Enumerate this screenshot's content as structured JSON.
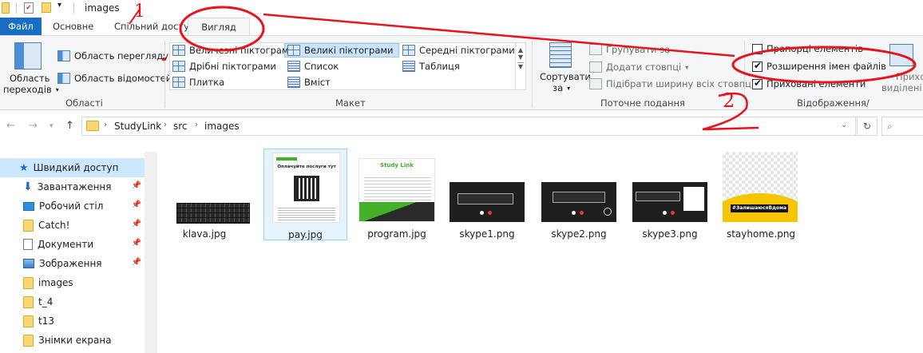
{
  "window": {
    "title": "images"
  },
  "tabs": [
    {
      "label": "Файл"
    },
    {
      "label": "Основне"
    },
    {
      "label": "Спільний доступ"
    },
    {
      "label": "Вигляд"
    }
  ],
  "ribbon": {
    "panes": {
      "nav_pane_line1": "Область",
      "nav_pane_line2": "переходів",
      "preview": "Область перегляду",
      "details": "Область відомостей",
      "group_label": "Області"
    },
    "layout": {
      "items": [
        "Величезні піктограми",
        "Великі піктограми",
        "Середні піктограми",
        "Дрібні піктограми",
        "Список",
        "Таблиця",
        "Плитка",
        "Вміст"
      ],
      "group_label": "Макет"
    },
    "current_view": {
      "sort_line1": "Сортувати",
      "sort_line2": "за",
      "group_by": "Групувати за",
      "add_columns": "Додати стовпці",
      "fit_columns": "Підібрати ширину всіх стовпців",
      "group_label": "Поточне подання"
    },
    "show_hide": {
      "item_checkboxes": "Прапорці елементів",
      "file_extensions": "Розширення імен файлів",
      "hidden_items": "Приховані елементи",
      "hide_line1": "Прихо",
      "hide_line2": "виділені е",
      "group_label": "Відображення/приховання"
    }
  },
  "address": {
    "crumbs": [
      "StudyLink",
      "src",
      "images"
    ]
  },
  "sidebar": {
    "items": [
      {
        "label": "Швидкий доступ"
      },
      {
        "label": "Завантаження"
      },
      {
        "label": "Робочий стіл"
      },
      {
        "label": "Catch!"
      },
      {
        "label": "Документи"
      },
      {
        "label": "Зображення"
      },
      {
        "label": "images"
      },
      {
        "label": "t_4"
      },
      {
        "label": "t13"
      },
      {
        "label": "Знімки екрана"
      }
    ]
  },
  "files": [
    {
      "name": "klava.jpg"
    },
    {
      "name": "pay.jpg",
      "t1": "Оплачуйте послуги тут"
    },
    {
      "name": "program.jpg",
      "t1": "Study Link"
    },
    {
      "name": "skype1.png"
    },
    {
      "name": "skype2.png"
    },
    {
      "name": "skype3.png"
    },
    {
      "name": "stayhome.png",
      "t1": "#ЗалишаюсяВдома"
    }
  ],
  "annotations": {
    "one": "1",
    "two": "2"
  },
  "colors": {
    "accent": "#1a6ec2",
    "annotation": "#e8141c",
    "selection": "#cce8ff"
  }
}
